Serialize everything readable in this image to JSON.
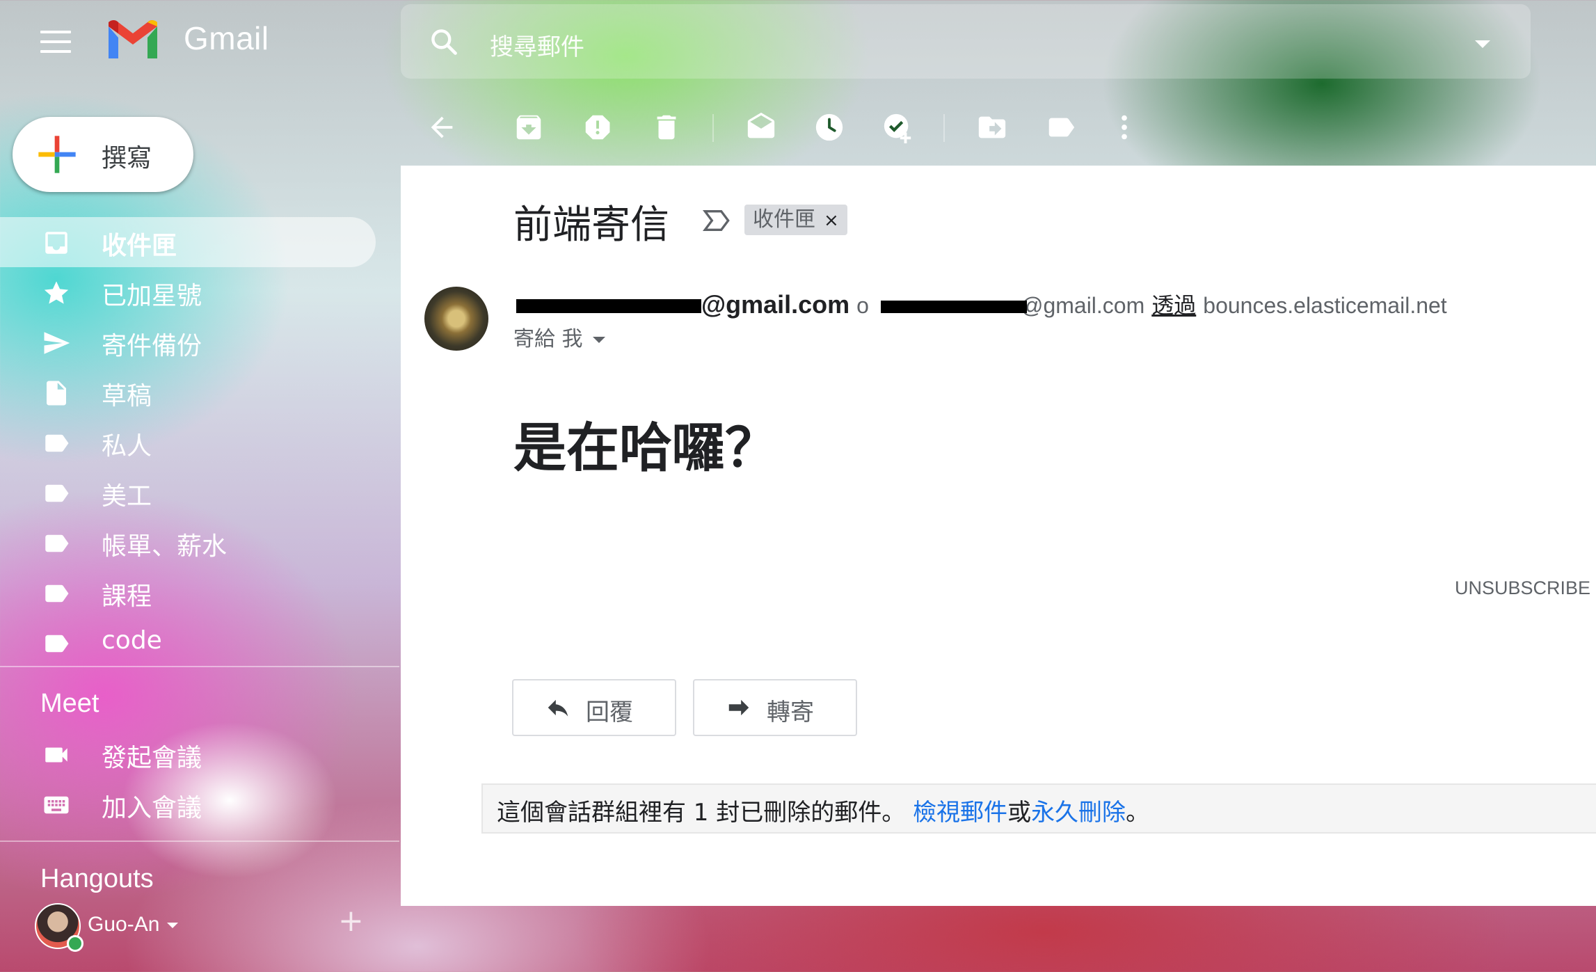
{
  "header": {
    "app_name": "Gmail",
    "search_placeholder": "搜尋郵件"
  },
  "toolbar": {
    "icons": [
      "back-arrow-icon",
      "archive-icon",
      "report-spam-icon",
      "delete-icon",
      "mark-unread-icon",
      "snooze-icon",
      "add-task-icon",
      "move-to-icon",
      "label-icon",
      "more-vert-icon"
    ]
  },
  "sidebar": {
    "compose_label": "撰寫",
    "items": [
      {
        "label": "收件匣",
        "icon": "inbox-icon",
        "active": true
      },
      {
        "label": "已加星號",
        "icon": "star-icon"
      },
      {
        "label": "寄件備份",
        "icon": "send-icon"
      },
      {
        "label": "草稿",
        "icon": "draft-icon"
      },
      {
        "label": "私人",
        "icon": "label-icon"
      },
      {
        "label": "美工",
        "icon": "label-icon"
      },
      {
        "label": "帳單、薪水",
        "icon": "label-icon"
      },
      {
        "label": "課程",
        "icon": "label-icon"
      },
      {
        "label": "code",
        "icon": "label-icon"
      }
    ],
    "meet": {
      "title": "Meet",
      "items": [
        {
          "label": "發起會議",
          "icon": "video-camera-icon"
        },
        {
          "label": "加入會議",
          "icon": "keyboard-icon"
        }
      ]
    },
    "hangouts": {
      "title": "Hangouts",
      "user_name": "Guo-An"
    }
  },
  "email": {
    "subject": "前端寄信",
    "label_chip": "收件匣",
    "label_remove": "×",
    "sender_name_suffix": "@gmail.com",
    "sender_email_prefix": "o",
    "sender_email_suffix": "@gmail.com",
    "via_text": "透過",
    "via_domain": "bounces.elasticemail.net",
    "recipient": "寄給 我",
    "body": "是在哈囉？",
    "unsubscribe": "UNSUBSCRIBE",
    "reply_label": "回覆",
    "forward_label": "轉寄",
    "notice": {
      "prefix": "這個會話群組裡有 1 封已刪除的郵件。 ",
      "view_link": "檢視郵件",
      "or": "或",
      "delete_link": "永久刪除",
      "suffix": "。"
    }
  },
  "colors": {
    "link": "#1a73e8",
    "text_primary": "#202124",
    "text_secondary": "#5f6368"
  }
}
